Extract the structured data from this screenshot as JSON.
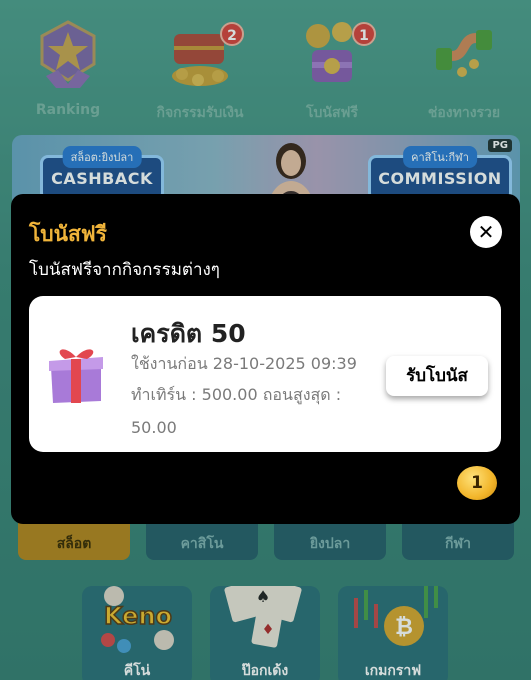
{
  "nav": {
    "items": [
      {
        "label": "Ranking",
        "badge": ""
      },
      {
        "label": "กิจกรรมรับเงิน",
        "badge": "2"
      },
      {
        "label": "โบนัสฟรี",
        "badge": "1"
      },
      {
        "label": "ช่องทางรวย",
        "badge": ""
      }
    ]
  },
  "banner": {
    "left_tag": "สล็อต:ยิงปลา",
    "left_title": "CASHBACK",
    "right_tag": "คาสิโน:กีฬา",
    "right_title": "COMMISSION",
    "badge": "PG"
  },
  "modal": {
    "title": "โบนัสฟรี",
    "subtitle": "โบนัสฟรีจากกิจกรรมต่างๆ",
    "close_icon": "close-icon",
    "card": {
      "credit": "เครดิต 50",
      "expire": "ใช้งานก่อน 28-10-2025 09:39",
      "turnover": "ทำเทิร์น : 500.00 ถอนสูงสุด : 50.00",
      "claim_label": "รับโบนัส",
      "icon": "gift-icon"
    },
    "page_indicator": "1"
  },
  "categories": [
    {
      "label": "สล็อต",
      "active": true
    },
    {
      "label": "คาสิโน",
      "active": false
    },
    {
      "label": "ยิงปลา",
      "active": false
    },
    {
      "label": "กีฬา",
      "active": false
    }
  ],
  "games": [
    {
      "label": "คีโน่",
      "logo": "Keno"
    },
    {
      "label": "ป๊อกเด้ง"
    },
    {
      "label": "เกมกราฟ"
    }
  ],
  "colors": {
    "accent": "#f0b43a",
    "badge_red": "#d8433b",
    "tab_active": "#b5851d",
    "tab_inactive": "#275e6a"
  }
}
